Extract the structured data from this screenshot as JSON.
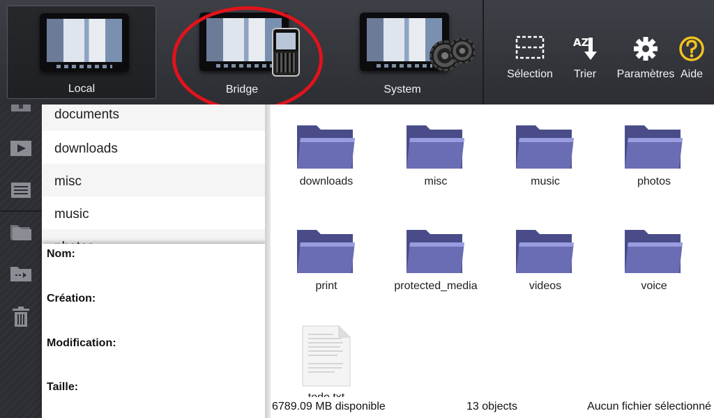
{
  "sources": [
    {
      "label": "Local"
    },
    {
      "label": "Bridge"
    },
    {
      "label": "System"
    }
  ],
  "toolbar": {
    "selection_label": "Sélection",
    "sort_label": "Trier",
    "settings_label": "Paramètres",
    "help_label": "Aide",
    "sort_icon_text": "AZ"
  },
  "left_strip": {
    "icons": [
      "upload-icon",
      "video-icon",
      "document-icon",
      "copy-icon",
      "move-icon",
      "trash-icon"
    ]
  },
  "folder_list": {
    "items": [
      "documents",
      "downloads",
      "misc",
      "music",
      "photos"
    ]
  },
  "info": {
    "name_label": "Nom:",
    "created_label": "Création:",
    "modified_label": "Modification:",
    "size_label": "Taille:"
  },
  "grid": {
    "items": [
      {
        "name": "downloads",
        "type": "folder"
      },
      {
        "name": "misc",
        "type": "folder"
      },
      {
        "name": "music",
        "type": "folder"
      },
      {
        "name": "photos",
        "type": "folder"
      },
      {
        "name": "print",
        "type": "folder"
      },
      {
        "name": "protected_media",
        "type": "folder"
      },
      {
        "name": "videos",
        "type": "folder"
      },
      {
        "name": "voice",
        "type": "folder"
      },
      {
        "name": "todo.txt",
        "type": "file"
      }
    ]
  },
  "status": {
    "free_space": "6789.09 MB disponible",
    "object_count": "13 objects",
    "selection": "Aucun fichier sélectionné"
  },
  "colors": {
    "folder": "#6a6cb4",
    "highlight_ring": "#e0131b",
    "help_icon": "#f4c21e"
  }
}
